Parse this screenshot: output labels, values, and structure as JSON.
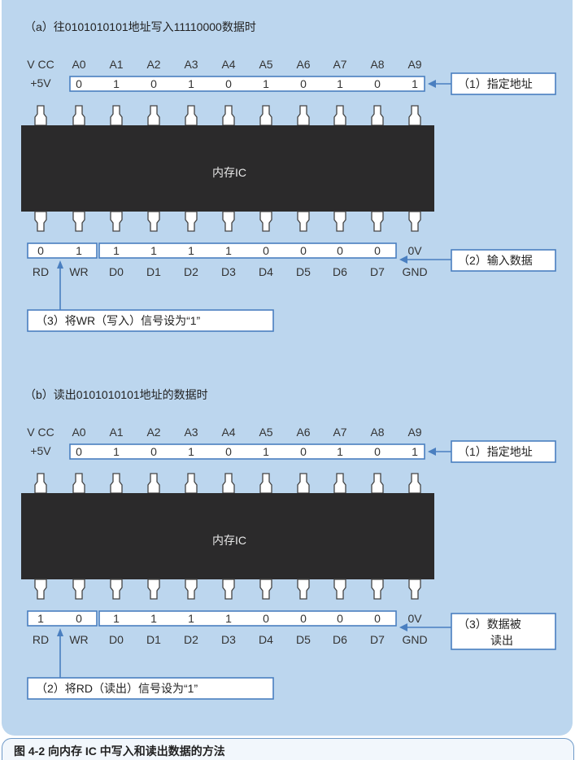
{
  "caption": "图 4-2   向内存 IC 中写入和读出数据的方法",
  "colors": {
    "panel": "#bcd6ee",
    "chip": "#2b2a2b",
    "box": "#4a7fc0",
    "text": "#333333",
    "chipText": "#e8e8e8"
  },
  "sections": [
    {
      "heading": "（a）往0101010101地址写入11110000数据时",
      "chip_label": "内存IC",
      "top_labels": [
        "V CC",
        "A0",
        "A1",
        "A2",
        "A3",
        "A4",
        "A5",
        "A6",
        "A7",
        "A8",
        "A9"
      ],
      "vcc_value": "+5V",
      "address_bits": [
        "0",
        "1",
        "0",
        "1",
        "0",
        "1",
        "0",
        "1",
        "0",
        "1"
      ],
      "address_note": "（1）指定地址",
      "control_bits": [
        "0",
        "1"
      ],
      "data_bits": [
        "1",
        "1",
        "1",
        "1",
        "0",
        "0",
        "0",
        "0"
      ],
      "gnd_value": "0V",
      "bottom_labels": [
        "RD",
        "WR",
        "D0",
        "D1",
        "D2",
        "D3",
        "D4",
        "D5",
        "D6",
        "D7",
        "GND"
      ],
      "data_note": [
        "（2）输入数据"
      ],
      "control_note": "（3）将WR（写入）信号设为“1”",
      "control_arrow_target": "WR"
    },
    {
      "heading": "（b）读出0101010101地址的数据时",
      "chip_label": "内存IC",
      "top_labels": [
        "V CC",
        "A0",
        "A1",
        "A2",
        "A3",
        "A4",
        "A5",
        "A6",
        "A7",
        "A8",
        "A9"
      ],
      "vcc_value": "+5V",
      "address_bits": [
        "0",
        "1",
        "0",
        "1",
        "0",
        "1",
        "0",
        "1",
        "0",
        "1"
      ],
      "address_note": "（1）指定地址",
      "control_bits": [
        "1",
        "0"
      ],
      "data_bits": [
        "1",
        "1",
        "1",
        "1",
        "0",
        "0",
        "0",
        "0"
      ],
      "gnd_value": "0V",
      "bottom_labels": [
        "RD",
        "WR",
        "D0",
        "D1",
        "D2",
        "D3",
        "D4",
        "D5",
        "D6",
        "D7",
        "GND"
      ],
      "data_note": [
        "（3）数据被",
        "读出"
      ],
      "control_note": "（2）将RD（读出）信号设为“1”",
      "control_arrow_target": "RD"
    }
  ]
}
